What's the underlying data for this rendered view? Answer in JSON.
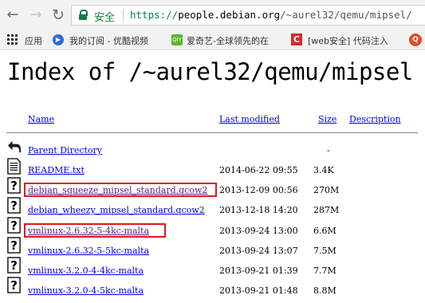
{
  "browser": {
    "nav": {
      "back_glyph": "←",
      "forward_glyph": "→",
      "reload_glyph": "↻"
    },
    "address_bar": {
      "security_label": "安全",
      "scheme": "https://",
      "host": "people.debian.org",
      "path": "/~aurel32/qemu/mipsel/"
    },
    "bookmarks": [
      {
        "icon": "apps-grid-icon",
        "label": "应用"
      },
      {
        "icon": "youku-icon",
        "label": "我的订阅 - 优酷视频"
      },
      {
        "icon": "iqiyi-icon",
        "label": "爱奇艺-全球领先的在"
      },
      {
        "icon": "c-logo-icon",
        "label": "[web安全] 代码注入"
      },
      {
        "icon": "q-logo-icon",
        "label": ""
      }
    ]
  },
  "page": {
    "title": "Index of /~aurel32/qemu/mipsel",
    "columns": {
      "name": "Name",
      "last_modified": "Last modified",
      "size": "Size",
      "description": "Description"
    },
    "rows": [
      {
        "icon": "back-arrow-icon",
        "name": "Parent Directory",
        "date": "",
        "size": "-"
      },
      {
        "icon": "text-file-icon",
        "name": "README.txt",
        "date": "2014-06-22 09:55",
        "size": "3.4K"
      },
      {
        "icon": "unknown-file-icon",
        "name": "debian_squeeze_mipsel_standard.qcow2",
        "date": "2013-12-09 00:56",
        "size": "270M"
      },
      {
        "icon": "unknown-file-icon",
        "name": "debian_wheezy_mipsel_standard.qcow2",
        "date": "2013-12-18 14:20",
        "size": "287M"
      },
      {
        "icon": "unknown-file-icon",
        "name": "vmlinux-2.6.32-5-4kc-malta",
        "date": "2013-09-24 13:00",
        "size": "6.6M"
      },
      {
        "icon": "unknown-file-icon",
        "name": "vmlinux-2.6.32-5-5kc-malta",
        "date": "2013-09-24 13:07",
        "size": "7.5M"
      },
      {
        "icon": "unknown-file-icon",
        "name": "vmlinux-3.2.0-4-4kc-malta",
        "date": "2013-09-21 01:39",
        "size": "7.7M"
      },
      {
        "icon": "unknown-file-icon",
        "name": "vmlinux-3.2.0-4-5kc-malta",
        "date": "2013-09-21 01:48",
        "size": "8.8M"
      }
    ]
  },
  "colors": {
    "link": "#0000ee",
    "visited": "#551a8b",
    "highlight": "#e0161e",
    "secure": "#0b8043"
  }
}
